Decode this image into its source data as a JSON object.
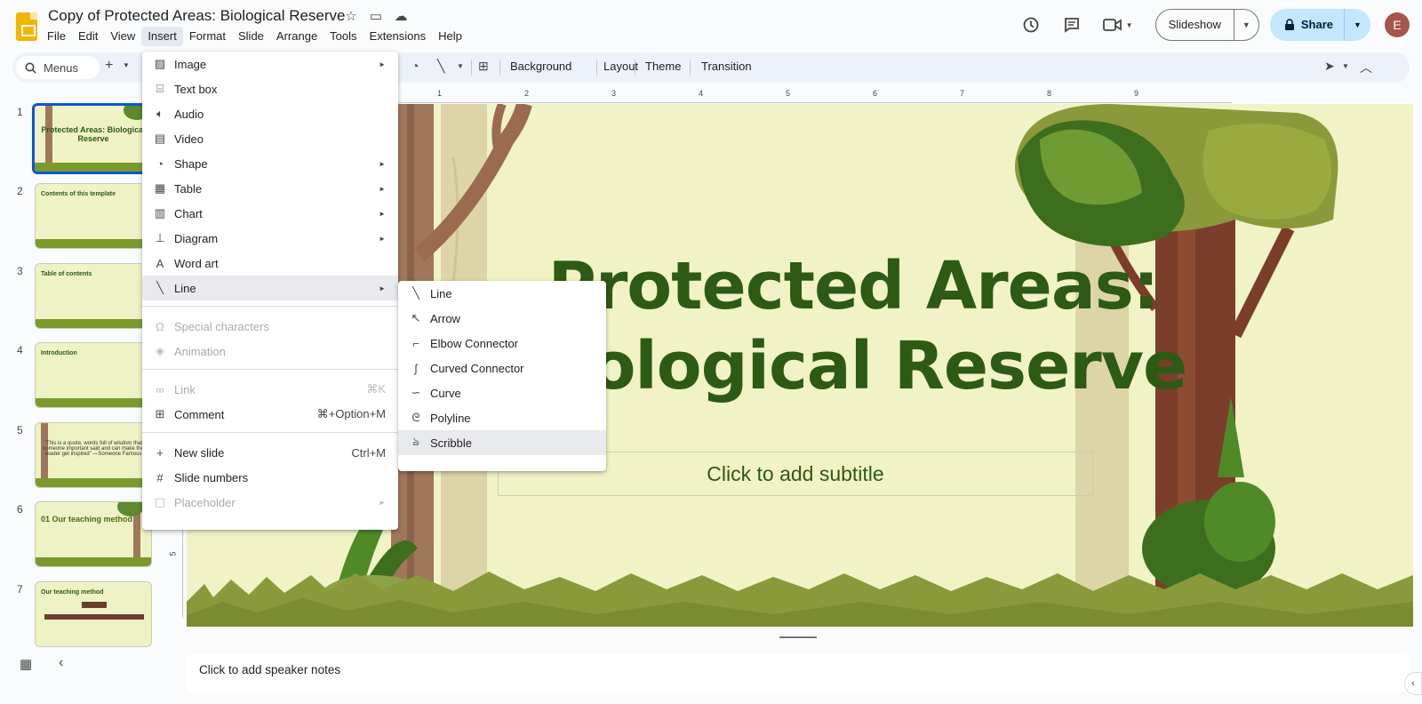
{
  "header": {
    "doc_title": "Copy of Protected Areas: Biological Reserve",
    "title_icons": [
      "star-icon",
      "move-folder-icon",
      "cloud-saved-icon"
    ],
    "menus": [
      "File",
      "Edit",
      "View",
      "Insert",
      "Format",
      "Slide",
      "Arrange",
      "Tools",
      "Extensions",
      "Help"
    ],
    "active_menu": "Insert",
    "slideshow_label": "Slideshow",
    "share_label": "Share",
    "avatar_initial": "E"
  },
  "toolbar": {
    "search_label": "Menus",
    "background_label": "Background",
    "layout_label": "Layout",
    "theme_label": "Theme",
    "transition_label": "Transition"
  },
  "filmstrip": {
    "slides": [
      {
        "num": "1",
        "text": "Protected Areas: Biological Reserve"
      },
      {
        "num": "2",
        "text": "Contents of this template"
      },
      {
        "num": "3",
        "text": "Table of contents"
      },
      {
        "num": "4",
        "text": "Introduction"
      },
      {
        "num": "5",
        "text": "\"This is a quote, words full of wisdom that someone important said and can make the reader get inspired\" —Someone Famous"
      },
      {
        "num": "6",
        "text": "01 Our teaching method"
      },
      {
        "num": "7",
        "text": "Our teaching method"
      }
    ]
  },
  "rulers": {
    "horizontal": [
      "1",
      "2",
      "3",
      "4",
      "5",
      "6",
      "7",
      "8",
      "9"
    ],
    "vertical": [
      "5"
    ]
  },
  "slide": {
    "title_line1": "Protected Areas:",
    "title_line2": "Biological Reserve",
    "subtitle_placeholder": "Click to add subtitle"
  },
  "notes_placeholder": "Click to add speaker notes",
  "insert_menu": {
    "items": [
      {
        "label": "Image",
        "icon": "image-icon",
        "submenu": true
      },
      {
        "label": "Text box",
        "icon": "text-box-icon"
      },
      {
        "label": "Audio",
        "icon": "audio-icon"
      },
      {
        "label": "Video",
        "icon": "video-icon"
      },
      {
        "label": "Shape",
        "icon": "shape-icon",
        "submenu": true
      },
      {
        "label": "Table",
        "icon": "table-icon",
        "submenu": true
      },
      {
        "label": "Chart",
        "icon": "chart-icon",
        "submenu": true
      },
      {
        "label": "Diagram",
        "icon": "diagram-icon",
        "submenu": true
      },
      {
        "label": "Word art",
        "icon": "word-art-icon"
      },
      {
        "label": "Line",
        "icon": "line-icon",
        "submenu": true,
        "highlighted": true
      },
      {
        "label": "Special characters",
        "icon": "omega-icon",
        "disabled": true
      },
      {
        "label": "Animation",
        "icon": "animation-icon",
        "disabled": true
      },
      {
        "label": "Link",
        "icon": "link-icon",
        "shortcut": "⌘K",
        "disabled": true
      },
      {
        "label": "Comment",
        "icon": "comment-icon",
        "shortcut": "⌘+Option+M"
      },
      {
        "label": "New slide",
        "icon": "plus-icon",
        "shortcut": "Ctrl+M"
      },
      {
        "label": "Slide numbers",
        "icon": "hash-icon"
      },
      {
        "label": "Placeholder",
        "icon": "placeholder-icon",
        "submenu": true,
        "disabled": true
      }
    ]
  },
  "line_menu": {
    "items": [
      {
        "label": "Line",
        "icon": "line-icon"
      },
      {
        "label": "Arrow",
        "icon": "arrow-icon"
      },
      {
        "label": "Elbow Connector",
        "icon": "elbow-connector-icon"
      },
      {
        "label": "Curved Connector",
        "icon": "curved-connector-icon"
      },
      {
        "label": "Curve",
        "icon": "curve-icon"
      },
      {
        "label": "Polyline",
        "icon": "polyline-icon"
      },
      {
        "label": "Scribble",
        "icon": "scribble-icon",
        "highlighted": true
      }
    ]
  },
  "colors": {
    "slide_background": "#f1f3c7",
    "title_green": "#2d5a14",
    "selection_blue": "#0b57d0",
    "share_blue": "#c2e7ff"
  }
}
